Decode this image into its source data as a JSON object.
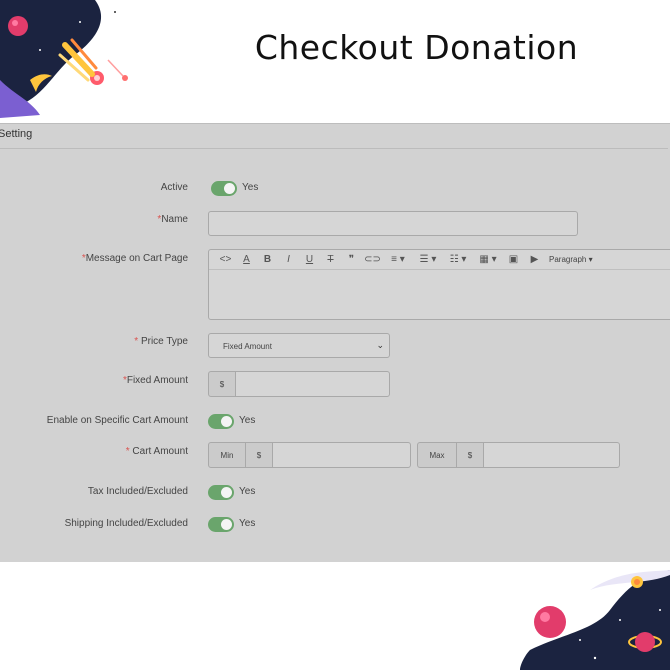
{
  "page_title": "Checkout Donation",
  "panel": {
    "header": "Setting"
  },
  "fields": {
    "active": {
      "label": "Active",
      "toggle_text": "Yes"
    },
    "name": {
      "required_mark": "*",
      "label": "Name",
      "value": ""
    },
    "message": {
      "required_mark": "*",
      "label": "Message on Cart Page",
      "toolbar": {
        "code": "<>",
        "font_color": "A",
        "bold": "B",
        "italic": "I",
        "underline": "U",
        "strikethrough": "T",
        "quote": "❞",
        "link": "⊂⊃",
        "align": "≡ ▾",
        "bullets": "☰ ▾",
        "numbers": "☷ ▾",
        "table": "▦ ▾",
        "image": "▣",
        "video": "▶",
        "paragraph": "Paragraph ▾"
      }
    },
    "price_type": {
      "required_mark": "*",
      "label": "Price Type",
      "selected": "Fixed Amount"
    },
    "fixed_amount": {
      "required_mark": "*",
      "label": "Fixed Amount",
      "currency": "$",
      "value": ""
    },
    "enable_specific": {
      "label": "Enable on Specific Cart Amount",
      "toggle_text": "Yes"
    },
    "cart_amount": {
      "required_mark": "*",
      "label": "Cart Amount",
      "min_label": "Min",
      "min_currency": "$",
      "max_label": "Max",
      "max_currency": "$"
    },
    "tax": {
      "label": "Tax Included/Excluded",
      "toggle_text": "Yes"
    },
    "shipping": {
      "label": "Shipping Included/Excluded",
      "toggle_text": "Yes"
    }
  },
  "colors": {
    "toggle_on": "#6aa56c",
    "required": "#d9534f",
    "panel_bg": "#d2d2d2"
  }
}
